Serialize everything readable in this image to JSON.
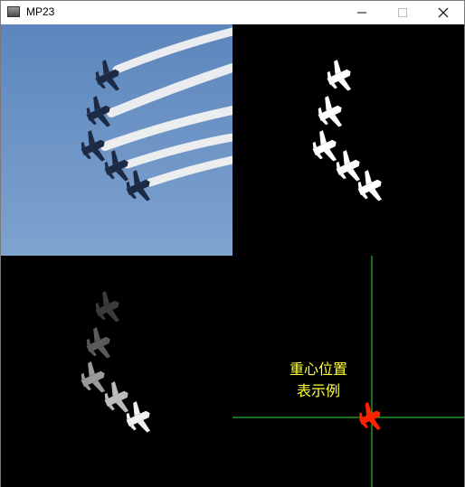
{
  "window": {
    "title": "MP23",
    "controls": {
      "minimize": "minimize-icon",
      "maximize": "maximize-icon",
      "close": "close-icon"
    }
  },
  "panes": {
    "photo": {
      "icon": "jet-formation-photo"
    },
    "mask": {
      "icon": "binary-mask"
    },
    "gray": {
      "icon": "labeled-gray-regions"
    },
    "centroid": {
      "caption_line1": "重心位置",
      "caption_line2": "表示例",
      "colors": {
        "crosshair": "#33dd33",
        "target": "#ff2200",
        "caption": "#ffff33"
      }
    }
  }
}
